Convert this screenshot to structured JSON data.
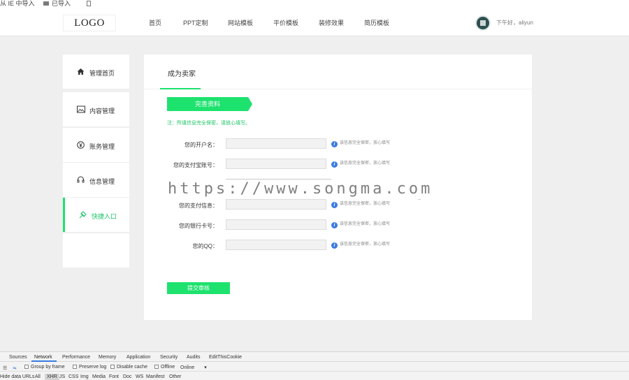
{
  "bookmarks": {
    "item1": "从 IE 中导入",
    "item2": "已导入"
  },
  "header": {
    "logo": "LOGO",
    "nav": [
      "首页",
      "PPT定制",
      "网站模板",
      "平价模板",
      "装修效果",
      "简历模板"
    ],
    "greeting": "下午好，aliyun"
  },
  "sidebar": {
    "items": [
      {
        "label": "管理首页",
        "icon": "home-icon"
      },
      {
        "label": "内容管理",
        "icon": "image-icon"
      },
      {
        "label": "账务管理",
        "icon": "yen-icon"
      },
      {
        "label": "信息管理",
        "icon": "headset-icon"
      },
      {
        "label": "快捷入口",
        "icon": "shortcut-icon",
        "active": true
      }
    ]
  },
  "main": {
    "tab_title": "成为卖家",
    "ribbon_label": "完善资料",
    "notice": "注：所填信息完全保密，请放心填写。",
    "form": [
      {
        "label": "您的开户名：",
        "value": "",
        "hint": "该信息完全保密，放心填写"
      },
      {
        "label": "您的支付宝账号：",
        "value": "",
        "hint": "该信息完全保密，放心填写"
      },
      {
        "label": "您的支付信息：",
        "value": "",
        "hint": "该信息完全保密，放心填写"
      },
      {
        "label": "您的银行卡号：",
        "value": "",
        "hint": "该信息完全保密，放心填写"
      },
      {
        "label": "您的QQ：",
        "value": "",
        "hint": "该信息完全保密，放心填写"
      }
    ],
    "submit_label": "提交审核"
  },
  "watermark": "https://www.songma.com",
  "devtools": {
    "tabs": [
      "Sources",
      "Network",
      "Performance",
      "Memory",
      "Application",
      "Security",
      "Audits",
      "EditThisCookie"
    ],
    "active_tab": "Network",
    "toolbar": {
      "group_by_frame": "Group by frame",
      "preserve_log": "Preserve log",
      "disable_cache": "Disable cache",
      "offline": "Offline",
      "throttle": "Online"
    },
    "filters": [
      "Hide data URLs",
      "All",
      "XHR",
      "JS",
      "CSS",
      "Img",
      "Media",
      "Font",
      "Doc",
      "WS",
      "Manifest",
      "Other"
    ],
    "active_filter": "XHR"
  },
  "colors": {
    "accent": "#1de26e",
    "page_bg": "#efefef",
    "info_blue": "#3a7be0"
  }
}
